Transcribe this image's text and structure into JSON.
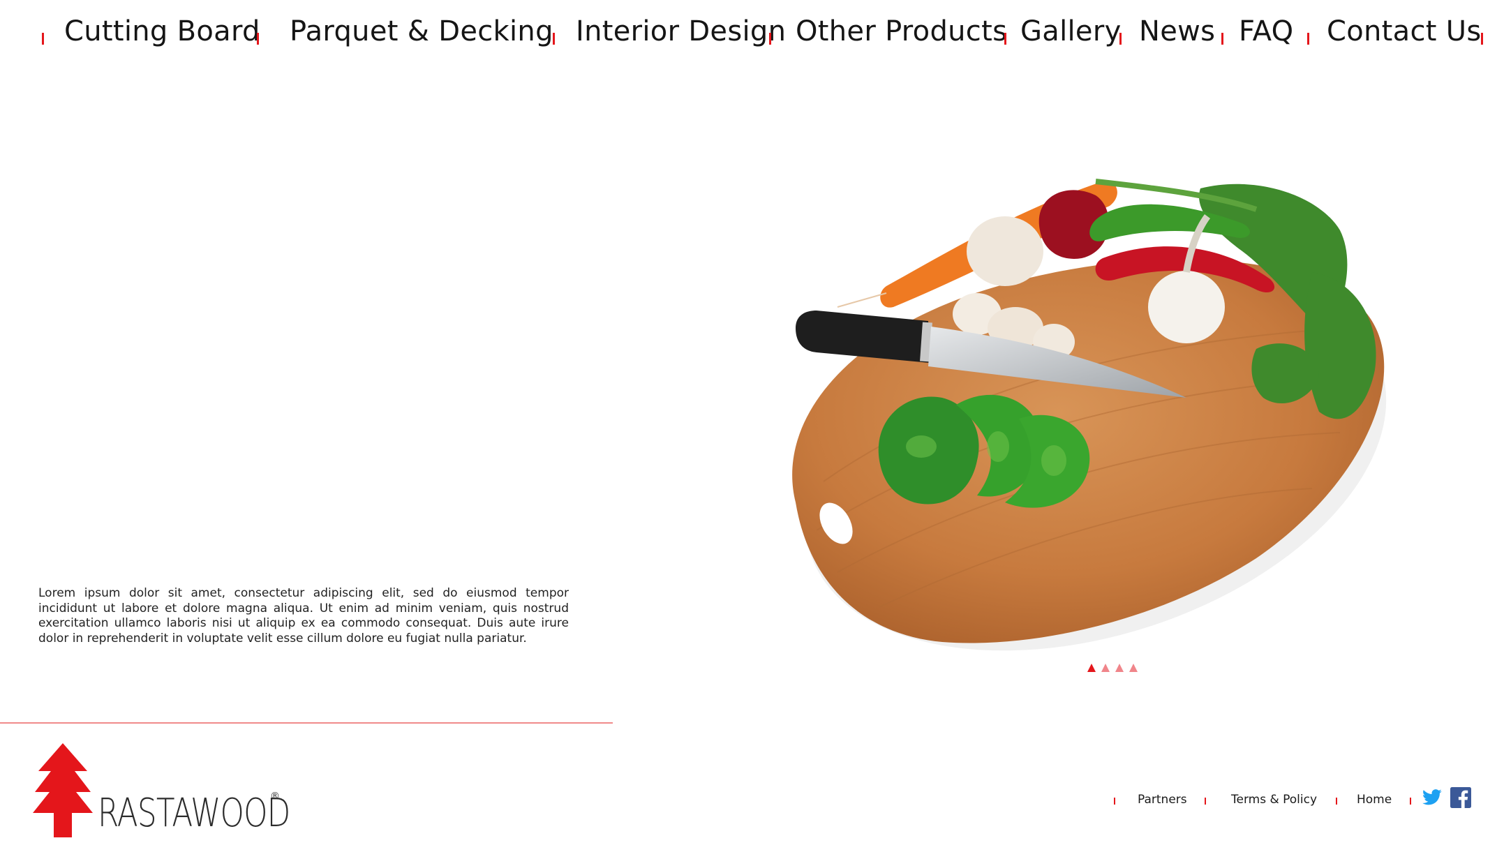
{
  "nav": {
    "items": [
      {
        "label": "Cutting Board"
      },
      {
        "label": "Parquet & Decking"
      },
      {
        "label": "Interior Design"
      },
      {
        "label": "Other Products"
      },
      {
        "label": "Gallery"
      },
      {
        "label": "News"
      },
      {
        "label": "FAQ"
      },
      {
        "label": "Contact Us"
      }
    ]
  },
  "main": {
    "intro_text": "Lorem ipsum dolor sit amet, consectetur adipiscing elit, sed do eiusmod tempor incididunt ut labore et dolore magna aliqua. Ut enim ad minim veniam, quis nostrud exercitation ullamco laboris nisi ut aliquip ex ea commodo consequat. Duis aute irure dolor in reprehenderit in voluptate velit esse cillum dolore eu fugiat nulla pariatur.",
    "carousel": {
      "slide_count": 4,
      "active_index": 0
    }
  },
  "footer": {
    "brand": "RASTAWOOD",
    "registered_mark": "®",
    "links": [
      {
        "label": "Partners"
      },
      {
        "label": "Terms & Policy"
      },
      {
        "label": "Home"
      }
    ],
    "social": [
      "twitter-icon",
      "facebook-icon"
    ]
  },
  "colors": {
    "accent": "#e4161b",
    "accent_light": "#f0858a",
    "text": "#151515",
    "twitter": "#1da1f2",
    "facebook": "#3b5998"
  }
}
